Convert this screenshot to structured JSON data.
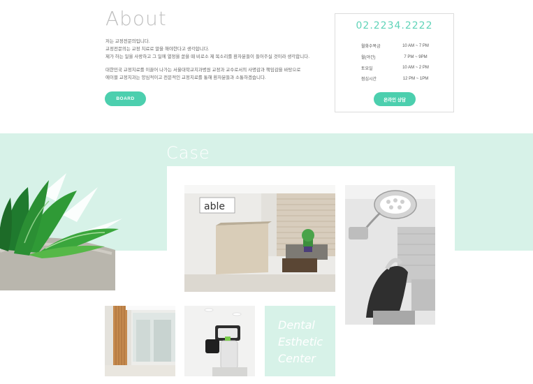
{
  "about": {
    "title": "About",
    "paragraph1": [
      "저는 교정전문의입니다.",
      "교정전문의는 교정 치료로 말을 해야한다고 생각합니다.",
      "제가 하는 일을 사랑하고 그 일에 열정을 쏟을 때 비로소 제 목소리를 환자분들이 들어주실 것이라 생각합니다."
    ],
    "paragraph2": [
      "대한민국 교정치료를 이끌어 나가는 서울대학교치과병원 교정과 교수로서의 사명감과 책임감을 바탕으로",
      "에이블 교정치과는 양심적이고 전문적인 교정치료를 통해 환자분들과 소통하겠습니다."
    ],
    "board_label": "BOARD"
  },
  "contact": {
    "phone": "02.2234.2222",
    "hours": [
      {
        "day": "월화수목금",
        "time": "10 AM  ~  7 PM"
      },
      {
        "day": "월(야간)",
        "time": "7 PM  ~  9PM"
      },
      {
        "day": "토요일",
        "time": "10 AM  ~  2 PM"
      },
      {
        "day": "점심시간",
        "time": "12 PM  ~  1PM"
      }
    ],
    "consult_label": "온라인 상담"
  },
  "case": {
    "title": "Case",
    "reception_logo": "able",
    "esthetic_lines": [
      "Dental",
      "Esthetic",
      "Center"
    ]
  },
  "colors": {
    "accent": "#4ccfae",
    "mint_bg": "#d7f2e8",
    "phone": "#5fd3b8"
  }
}
